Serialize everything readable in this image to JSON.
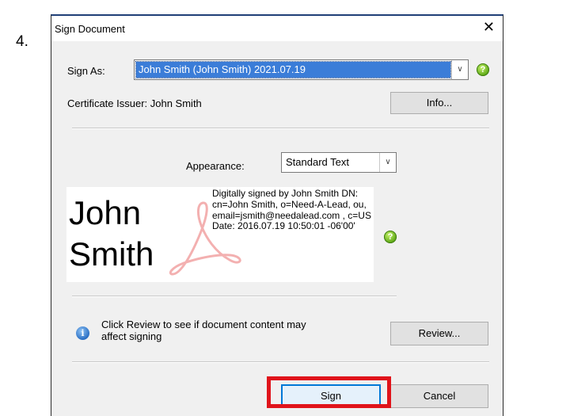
{
  "step_number": "4.",
  "window": {
    "title": "Sign Document",
    "close_glyph": "✕"
  },
  "sign_as": {
    "label": "Sign As:",
    "value": "John Smith (John Smith) 2021.07.19",
    "help_glyph": "?"
  },
  "certificate": {
    "issuer_label": "Certificate Issuer: John Smith",
    "info_button": "Info..."
  },
  "appearance": {
    "label": "Appearance:",
    "value": "Standard Text",
    "help_glyph": "?"
  },
  "signature_preview": {
    "name_line1": "John",
    "name_line2": "Smith",
    "details": "Digitally signed by John Smith DN: cn=John Smith, o=Need-A-Lead, ou, email=jsmith@needalead.com , c=US Date: 2016.07.19 10:50:01 -06'00'",
    "watermark_icon": "adobe-acrobat-icon"
  },
  "review": {
    "message": "Click Review to see if document content may affect signing",
    "button": "Review...",
    "info_glyph": "i"
  },
  "actions": {
    "sign": "Sign",
    "cancel": "Cancel"
  },
  "colors": {
    "highlight": "#e0141b",
    "selection": "#3b7dd8",
    "help_green": "#5aa614"
  }
}
